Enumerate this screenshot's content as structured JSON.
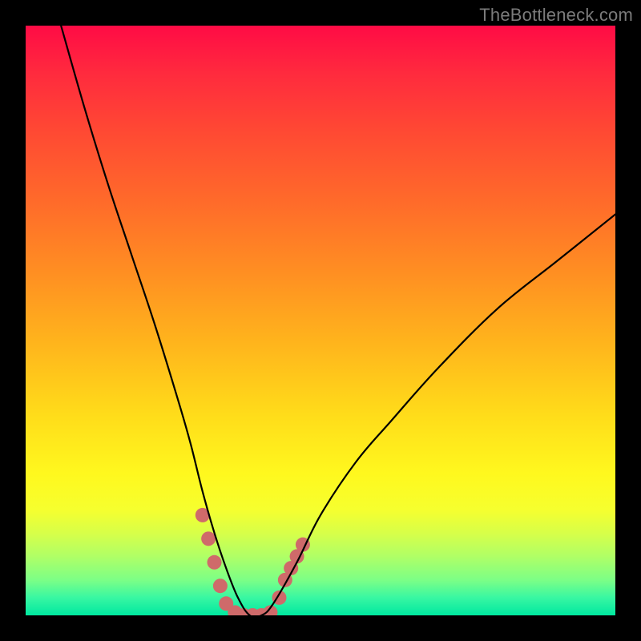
{
  "watermark": {
    "text": "TheBottleneck.com"
  },
  "chart_data": {
    "type": "line",
    "title": "",
    "xlabel": "",
    "ylabel": "",
    "xlim": [
      0,
      100
    ],
    "ylim": [
      0,
      100
    ],
    "grid": false,
    "legend": false,
    "background_gradient": {
      "direction": "vertical",
      "stops": [
        {
          "pos": 0.0,
          "color": "#ff0b45"
        },
        {
          "pos": 0.3,
          "color": "#ff6b2a"
        },
        {
          "pos": 0.66,
          "color": "#ffdc1a"
        },
        {
          "pos": 0.82,
          "color": "#f6ff2e"
        },
        {
          "pos": 1.0,
          "color": "#00e8a0"
        }
      ]
    },
    "series": [
      {
        "name": "bottleneck-curve",
        "color": "#000000",
        "x": [
          6,
          10,
          14,
          18,
          22,
          26,
          28,
          30,
          32,
          34,
          36,
          38,
          40,
          42,
          46,
          50,
          56,
          62,
          70,
          80,
          90,
          100
        ],
        "y": [
          100,
          86,
          73,
          61,
          49,
          36,
          29,
          21,
          14,
          8,
          3,
          0,
          0,
          2,
          9,
          17,
          26,
          33,
          42,
          52,
          60,
          68
        ]
      }
    ],
    "markers": [
      {
        "name": "range-markers",
        "shape": "dot",
        "color": "#cf6a6a",
        "radius_px": 9,
        "points": [
          {
            "x": 30,
            "y": 17
          },
          {
            "x": 31,
            "y": 13
          },
          {
            "x": 32,
            "y": 9
          },
          {
            "x": 33,
            "y": 5
          },
          {
            "x": 34,
            "y": 2
          },
          {
            "x": 35.5,
            "y": 0.5
          },
          {
            "x": 37,
            "y": 0
          },
          {
            "x": 38.5,
            "y": 0
          },
          {
            "x": 40,
            "y": 0
          },
          {
            "x": 41.5,
            "y": 0.5
          },
          {
            "x": 43,
            "y": 3
          },
          {
            "x": 44,
            "y": 6
          },
          {
            "x": 45,
            "y": 8
          },
          {
            "x": 46,
            "y": 10
          },
          {
            "x": 47,
            "y": 12
          }
        ]
      }
    ]
  }
}
